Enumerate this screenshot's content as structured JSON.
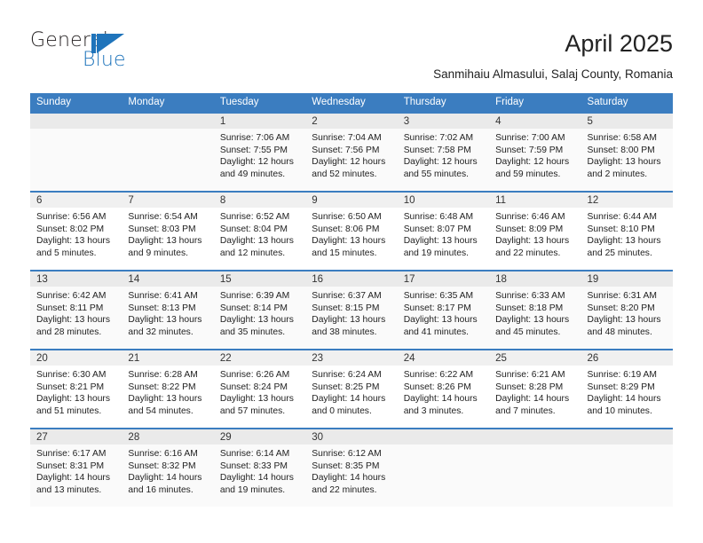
{
  "brand": {
    "name_part1": "General",
    "name_part2": "Blue"
  },
  "header": {
    "title": "April 2025",
    "subtitle": "Sanmihaiu Almasului, Salaj County, Romania"
  },
  "colors": {
    "header_blue": "#3b7dc0",
    "brand_blue": "#1f74bb",
    "band_gray": "#f0f0f0"
  },
  "calendar": {
    "weekday_headers": [
      "Sunday",
      "Monday",
      "Tuesday",
      "Wednesday",
      "Thursday",
      "Friday",
      "Saturday"
    ],
    "weeks": [
      [
        {
          "day": "",
          "sunrise": "",
          "sunset": "",
          "daylight1": "",
          "daylight2": ""
        },
        {
          "day": "",
          "sunrise": "",
          "sunset": "",
          "daylight1": "",
          "daylight2": ""
        },
        {
          "day": "1",
          "sunrise": "Sunrise: 7:06 AM",
          "sunset": "Sunset: 7:55 PM",
          "daylight1": "Daylight: 12 hours",
          "daylight2": "and 49 minutes."
        },
        {
          "day": "2",
          "sunrise": "Sunrise: 7:04 AM",
          "sunset": "Sunset: 7:56 PM",
          "daylight1": "Daylight: 12 hours",
          "daylight2": "and 52 minutes."
        },
        {
          "day": "3",
          "sunrise": "Sunrise: 7:02 AM",
          "sunset": "Sunset: 7:58 PM",
          "daylight1": "Daylight: 12 hours",
          "daylight2": "and 55 minutes."
        },
        {
          "day": "4",
          "sunrise": "Sunrise: 7:00 AM",
          "sunset": "Sunset: 7:59 PM",
          "daylight1": "Daylight: 12 hours",
          "daylight2": "and 59 minutes."
        },
        {
          "day": "5",
          "sunrise": "Sunrise: 6:58 AM",
          "sunset": "Sunset: 8:00 PM",
          "daylight1": "Daylight: 13 hours",
          "daylight2": "and 2 minutes."
        }
      ],
      [
        {
          "day": "6",
          "sunrise": "Sunrise: 6:56 AM",
          "sunset": "Sunset: 8:02 PM",
          "daylight1": "Daylight: 13 hours",
          "daylight2": "and 5 minutes."
        },
        {
          "day": "7",
          "sunrise": "Sunrise: 6:54 AM",
          "sunset": "Sunset: 8:03 PM",
          "daylight1": "Daylight: 13 hours",
          "daylight2": "and 9 minutes."
        },
        {
          "day": "8",
          "sunrise": "Sunrise: 6:52 AM",
          "sunset": "Sunset: 8:04 PM",
          "daylight1": "Daylight: 13 hours",
          "daylight2": "and 12 minutes."
        },
        {
          "day": "9",
          "sunrise": "Sunrise: 6:50 AM",
          "sunset": "Sunset: 8:06 PM",
          "daylight1": "Daylight: 13 hours",
          "daylight2": "and 15 minutes."
        },
        {
          "day": "10",
          "sunrise": "Sunrise: 6:48 AM",
          "sunset": "Sunset: 8:07 PM",
          "daylight1": "Daylight: 13 hours",
          "daylight2": "and 19 minutes."
        },
        {
          "day": "11",
          "sunrise": "Sunrise: 6:46 AM",
          "sunset": "Sunset: 8:09 PM",
          "daylight1": "Daylight: 13 hours",
          "daylight2": "and 22 minutes."
        },
        {
          "day": "12",
          "sunrise": "Sunrise: 6:44 AM",
          "sunset": "Sunset: 8:10 PM",
          "daylight1": "Daylight: 13 hours",
          "daylight2": "and 25 minutes."
        }
      ],
      [
        {
          "day": "13",
          "sunrise": "Sunrise: 6:42 AM",
          "sunset": "Sunset: 8:11 PM",
          "daylight1": "Daylight: 13 hours",
          "daylight2": "and 28 minutes."
        },
        {
          "day": "14",
          "sunrise": "Sunrise: 6:41 AM",
          "sunset": "Sunset: 8:13 PM",
          "daylight1": "Daylight: 13 hours",
          "daylight2": "and 32 minutes."
        },
        {
          "day": "15",
          "sunrise": "Sunrise: 6:39 AM",
          "sunset": "Sunset: 8:14 PM",
          "daylight1": "Daylight: 13 hours",
          "daylight2": "and 35 minutes."
        },
        {
          "day": "16",
          "sunrise": "Sunrise: 6:37 AM",
          "sunset": "Sunset: 8:15 PM",
          "daylight1": "Daylight: 13 hours",
          "daylight2": "and 38 minutes."
        },
        {
          "day": "17",
          "sunrise": "Sunrise: 6:35 AM",
          "sunset": "Sunset: 8:17 PM",
          "daylight1": "Daylight: 13 hours",
          "daylight2": "and 41 minutes."
        },
        {
          "day": "18",
          "sunrise": "Sunrise: 6:33 AM",
          "sunset": "Sunset: 8:18 PM",
          "daylight1": "Daylight: 13 hours",
          "daylight2": "and 45 minutes."
        },
        {
          "day": "19",
          "sunrise": "Sunrise: 6:31 AM",
          "sunset": "Sunset: 8:20 PM",
          "daylight1": "Daylight: 13 hours",
          "daylight2": "and 48 minutes."
        }
      ],
      [
        {
          "day": "20",
          "sunrise": "Sunrise: 6:30 AM",
          "sunset": "Sunset: 8:21 PM",
          "daylight1": "Daylight: 13 hours",
          "daylight2": "and 51 minutes."
        },
        {
          "day": "21",
          "sunrise": "Sunrise: 6:28 AM",
          "sunset": "Sunset: 8:22 PM",
          "daylight1": "Daylight: 13 hours",
          "daylight2": "and 54 minutes."
        },
        {
          "day": "22",
          "sunrise": "Sunrise: 6:26 AM",
          "sunset": "Sunset: 8:24 PM",
          "daylight1": "Daylight: 13 hours",
          "daylight2": "and 57 minutes."
        },
        {
          "day": "23",
          "sunrise": "Sunrise: 6:24 AM",
          "sunset": "Sunset: 8:25 PM",
          "daylight1": "Daylight: 14 hours",
          "daylight2": "and 0 minutes."
        },
        {
          "day": "24",
          "sunrise": "Sunrise: 6:22 AM",
          "sunset": "Sunset: 8:26 PM",
          "daylight1": "Daylight: 14 hours",
          "daylight2": "and 3 minutes."
        },
        {
          "day": "25",
          "sunrise": "Sunrise: 6:21 AM",
          "sunset": "Sunset: 8:28 PM",
          "daylight1": "Daylight: 14 hours",
          "daylight2": "and 7 minutes."
        },
        {
          "day": "26",
          "sunrise": "Sunrise: 6:19 AM",
          "sunset": "Sunset: 8:29 PM",
          "daylight1": "Daylight: 14 hours",
          "daylight2": "and 10 minutes."
        }
      ],
      [
        {
          "day": "27",
          "sunrise": "Sunrise: 6:17 AM",
          "sunset": "Sunset: 8:31 PM",
          "daylight1": "Daylight: 14 hours",
          "daylight2": "and 13 minutes."
        },
        {
          "day": "28",
          "sunrise": "Sunrise: 6:16 AM",
          "sunset": "Sunset: 8:32 PM",
          "daylight1": "Daylight: 14 hours",
          "daylight2": "and 16 minutes."
        },
        {
          "day": "29",
          "sunrise": "Sunrise: 6:14 AM",
          "sunset": "Sunset: 8:33 PM",
          "daylight1": "Daylight: 14 hours",
          "daylight2": "and 19 minutes."
        },
        {
          "day": "30",
          "sunrise": "Sunrise: 6:12 AM",
          "sunset": "Sunset: 8:35 PM",
          "daylight1": "Daylight: 14 hours",
          "daylight2": "and 22 minutes."
        },
        {
          "day": "",
          "sunrise": "",
          "sunset": "",
          "daylight1": "",
          "daylight2": ""
        },
        {
          "day": "",
          "sunrise": "",
          "sunset": "",
          "daylight1": "",
          "daylight2": ""
        },
        {
          "day": "",
          "sunrise": "",
          "sunset": "",
          "daylight1": "",
          "daylight2": ""
        }
      ]
    ]
  }
}
